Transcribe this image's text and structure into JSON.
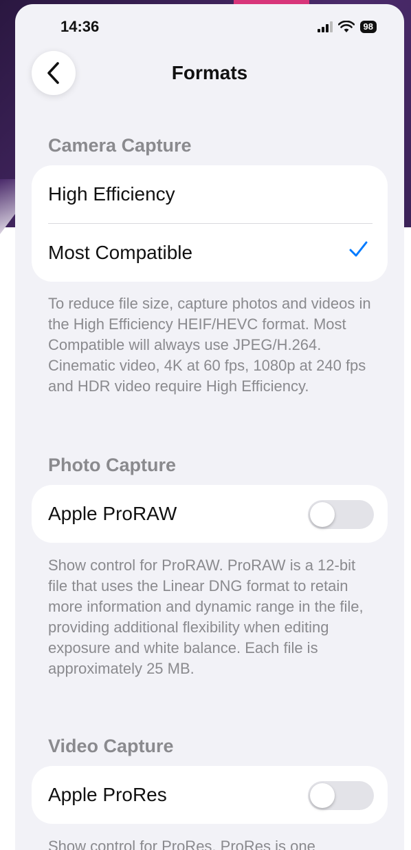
{
  "status": {
    "time": "14:36",
    "battery": "98"
  },
  "nav": {
    "title": "Formats"
  },
  "camera_capture": {
    "header": "Camera Capture",
    "options": [
      {
        "label": "High Efficiency",
        "selected": false
      },
      {
        "label": "Most Compatible",
        "selected": true
      }
    ],
    "footnote": "To reduce file size, capture photos and videos in the High Efficiency HEIF/HEVC format. Most Compatible will always use JPEG/H.264. Cinematic video, 4K at 60 fps, 1080p at 240 fps and HDR video require High Efficiency."
  },
  "photo_capture": {
    "header": "Photo Capture",
    "proraw_label": "Apple ProRAW",
    "proraw_on": false,
    "footnote": "Show control for ProRAW. ProRAW is a 12-bit file that uses the Linear DNG format to retain more information and dynamic range in the file, providing additional flexibility when editing exposure and white balance. Each file is approximately 25 MB."
  },
  "video_capture": {
    "header": "Video Capture",
    "prores_label": "Apple ProRes",
    "prores_on": false,
    "footnote_partial": "Show control for ProRes. ProRes is one"
  },
  "colors": {
    "accent": "#007aff",
    "background": "#f2f2f7",
    "secondary_text": "#8a8a8e"
  }
}
